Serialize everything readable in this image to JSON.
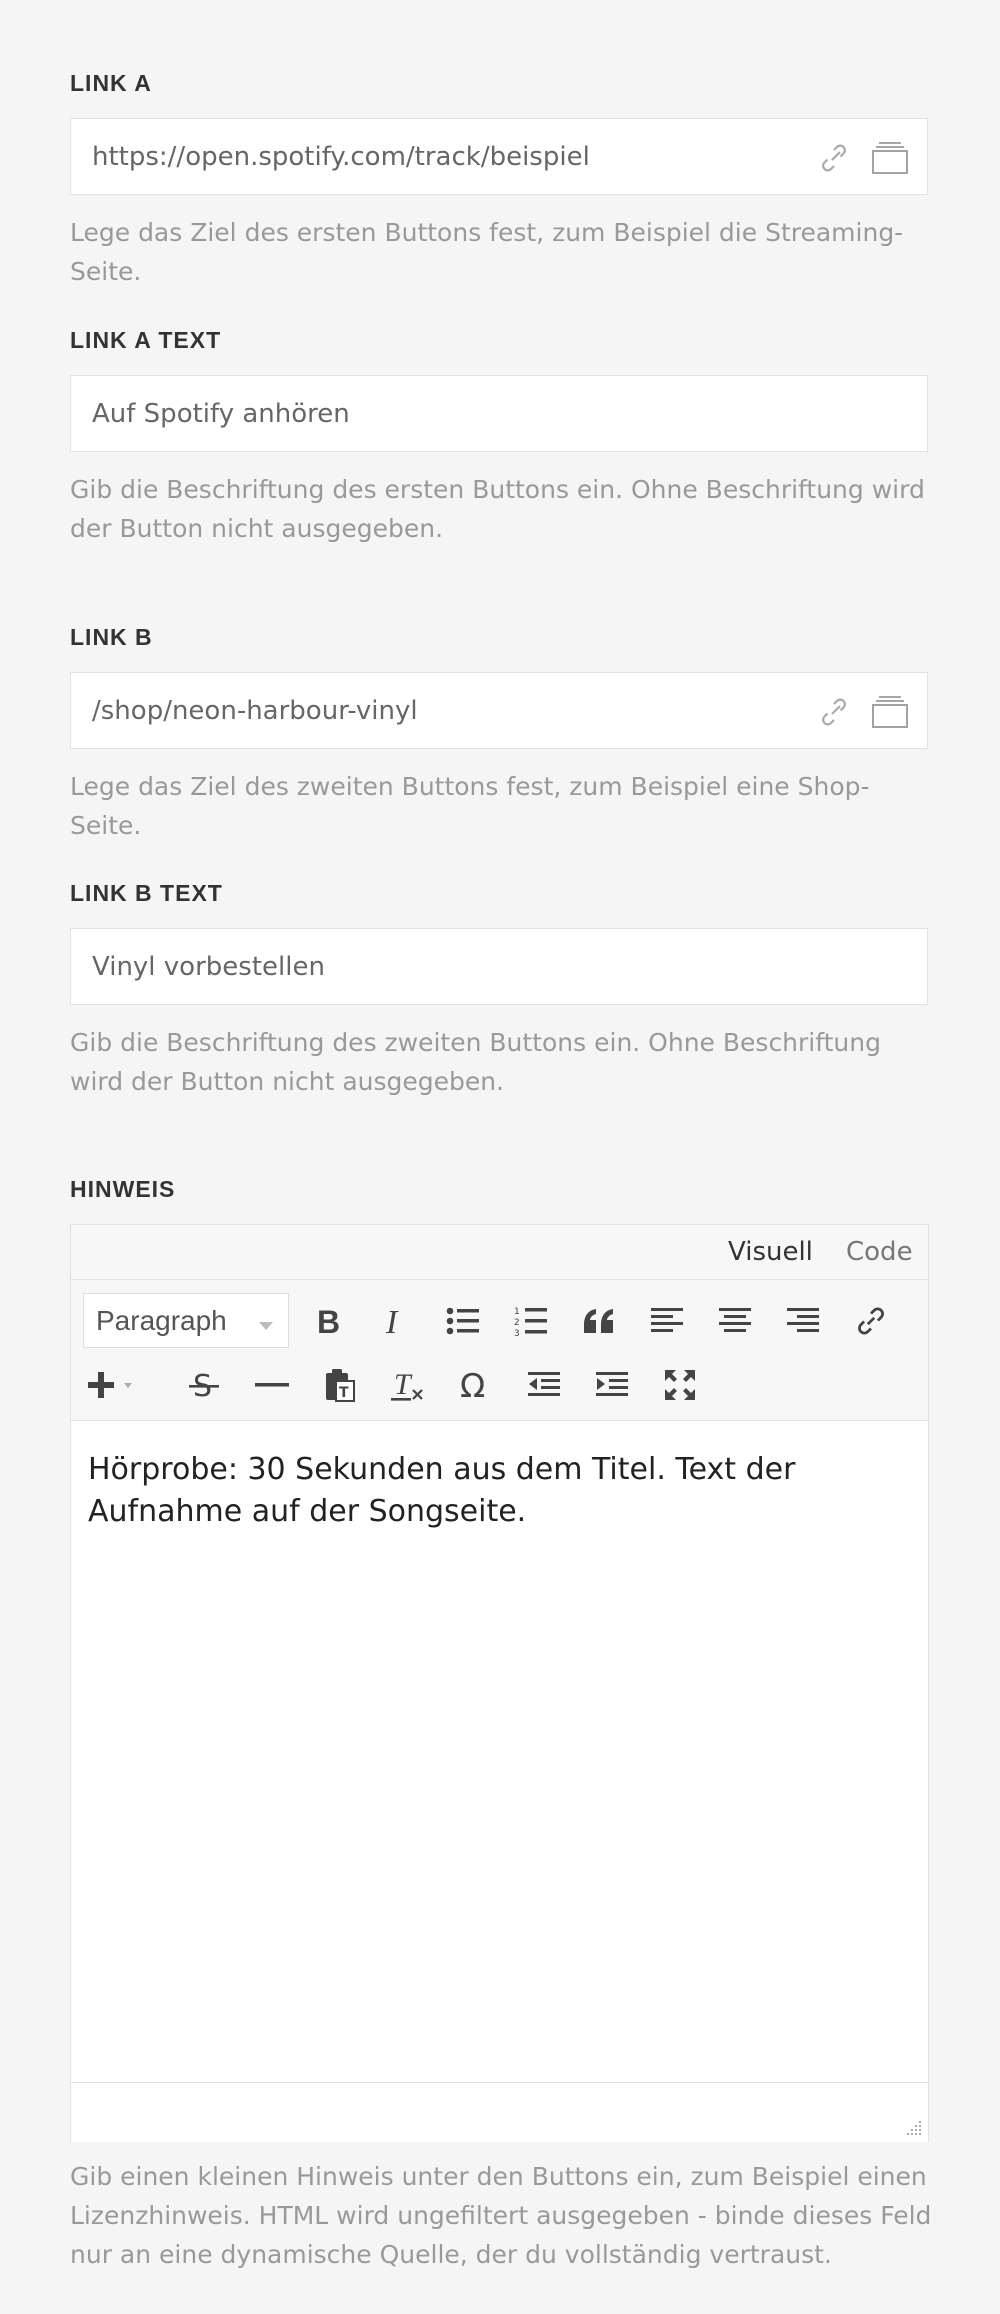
{
  "link_a": {
    "label": "LINK A",
    "value": "https://open.spotify.com/track/beispiel",
    "help": "Lege das Ziel des ersten Buttons fest, zum Beispiel die Streaming-Seite."
  },
  "link_a_text": {
    "label": "LINK A TEXT",
    "value": "Auf Spotify anhören",
    "help": "Gib die Beschriftung des ersten Buttons ein. Ohne Beschriftung wird der Button nicht ausgegeben."
  },
  "link_b": {
    "label": "LINK B",
    "value": "/shop/neon-harbour-vinyl",
    "help": "Lege das Ziel des zweiten Buttons fest, zum Beispiel eine Shop-Seite."
  },
  "link_b_text": {
    "label": "LINK B TEXT",
    "value": "Vinyl vorbestellen",
    "help": "Gib die Beschriftung des zweiten Buttons ein. Ohne Beschriftung wird der Button nicht ausgegeben."
  },
  "hinweis": {
    "label": "HINWEIS",
    "tab_visual": "Visuell",
    "tab_code": "Code",
    "format_value": "Paragraph",
    "content": "Hörprobe: 30 Sekunden aus dem Titel. Text der Aufnahme auf der Songseite.",
    "help": "Gib einen kleinen Hinweis unter den Buttons ein, zum Beispiel einen Lizenzhinweis. HTML wird ungefiltert ausgegeben - binde dieses Feld nur an eine dynamische Quelle, der du vollständig vertraust."
  },
  "icons": {
    "link": "link-icon",
    "browse": "browse-icon",
    "toolbar": [
      "bold-icon",
      "italic-icon",
      "bullet-list-icon",
      "numbered-list-icon",
      "blockquote-icon",
      "align-left-icon",
      "align-center-icon",
      "align-right-icon",
      "insert-link-icon",
      "add-icon",
      "strikethrough-icon",
      "horizontal-rule-icon",
      "paste-text-icon",
      "clear-formatting-icon",
      "special-character-icon",
      "outdent-icon",
      "indent-icon",
      "fullscreen-icon"
    ]
  },
  "colors": {
    "background": "#f5f5f5",
    "label": "#333333",
    "help": "#999999",
    "border": "#e2e2e2"
  }
}
